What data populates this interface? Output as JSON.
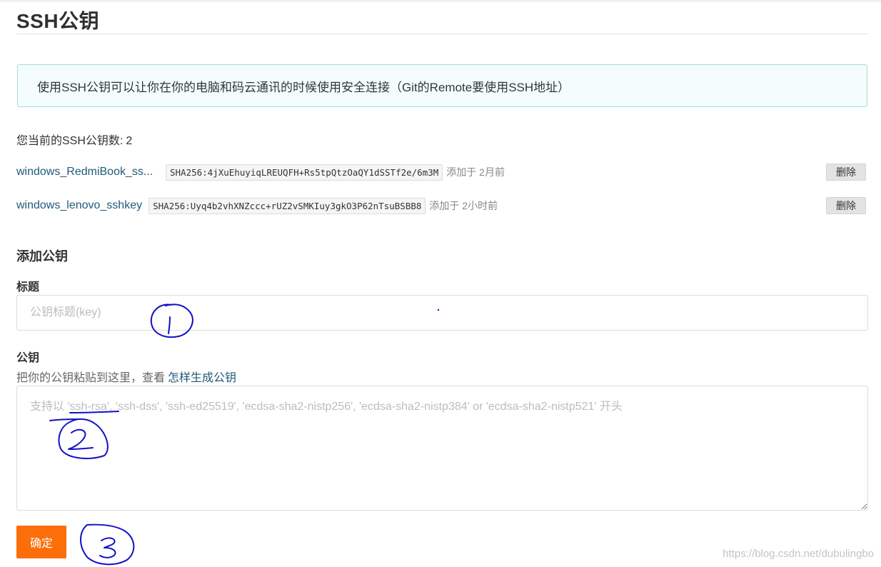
{
  "page": {
    "title": "SSH公钥"
  },
  "info_box": {
    "text": "使用SSH公钥可以让你在你的电脑和码云通讯的时候使用安全连接（Git的Remote要使用SSH地址）"
  },
  "key_count": {
    "label": "您当前的SSH公钥数:",
    "value": "2"
  },
  "keys": [
    {
      "name": "windows_RedmiBook_ss...",
      "fingerprint": "SHA256:4jXuEhuyiqLREUQFH+Rs5tpQtzOaQY1dSSTf2e/6m3M",
      "added": "添加于 2月前",
      "delete_label": "删除"
    },
    {
      "name": "windows_lenovo_sshkey",
      "fingerprint": "SHA256:Uyq4b2vhXNZccc+rUZ2vSMKIuy3gkO3P62nTsuBSBB8",
      "added": "添加于 2小时前",
      "delete_label": "删除"
    }
  ],
  "add_form": {
    "heading": "添加公钥",
    "title_label": "标题",
    "title_placeholder": "公钥标题(key)",
    "title_value": "",
    "key_label": "公钥",
    "key_hint": "把你的公钥粘贴到这里，查看",
    "key_hint_link": "怎样生成公钥",
    "key_placeholder": "支持以 'ssh-rsa', 'ssh-dss', 'ssh-ed25519', 'ecdsa-sha2-nistp256', 'ecdsa-sha2-nistp384' or 'ecdsa-sha2-nistp521' 开头",
    "key_value": "",
    "submit_label": "确定"
  },
  "watermark": "https://blog.csdn.net/dubulingbo",
  "colors": {
    "accent": "#fc6e0a",
    "link": "#1f5a7a",
    "info_border": "#a9dada",
    "info_bg": "#f4fcfc",
    "annotation_ink": "#1010c8"
  }
}
